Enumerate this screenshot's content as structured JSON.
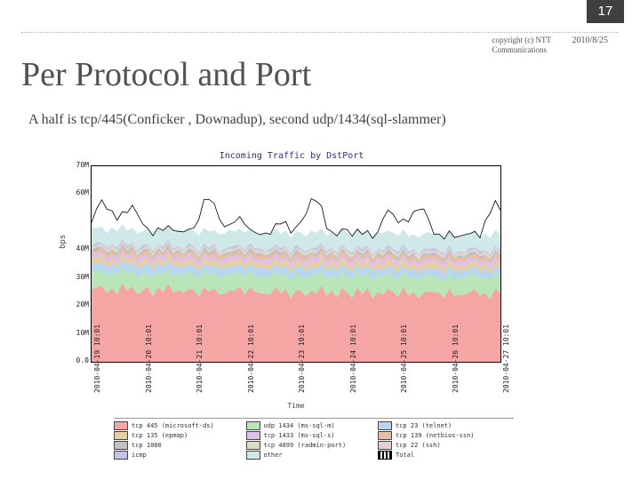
{
  "page_number": "17",
  "copyright_line1": "copyright (c) NTT",
  "copyright_line2": "Communications",
  "date": "2010/8/25",
  "title": "Per Protocol and Port",
  "subtitle": "A half is tcp/445(Conficker , Downadup), second udp/1434(sql-slammer)",
  "chart_data": {
    "type": "area",
    "title": "Incoming Traffic by DstPort",
    "xlabel": "Time",
    "ylabel": "bps",
    "ylim": [
      0,
      700000000
    ],
    "y_ticks": [
      "0.0",
      "10M",
      "20M",
      "30M",
      "40M",
      "60M",
      "70M"
    ],
    "categories": [
      "2010-04-19 10:01",
      "2010-04-20 10:01",
      "2010-04-21 10:01",
      "2010-04-22 10:01",
      "2010-04-23 10:01",
      "2010-04-24 10:01",
      "2010-04-25 10:01",
      "2010-04-26 10:01",
      "2010-04-27 10:01"
    ],
    "series": [
      {
        "name": "tcp 445 (microsoft-ds)",
        "color": "#f6a5a5",
        "values": [
          260,
          260,
          255,
          250,
          250,
          250,
          245,
          245,
          245
        ]
      },
      {
        "name": "udp 1434 (ms-sql-m)",
        "color": "#b9e6b9",
        "values": [
          60,
          60,
          60,
          60,
          60,
          60,
          60,
          60,
          60
        ]
      },
      {
        "name": "tcp 23 (telnet)",
        "color": "#b9d6f0",
        "values": [
          30,
          30,
          28,
          28,
          28,
          28,
          26,
          26,
          26
        ]
      },
      {
        "name": "tcp 135 (epmap)",
        "color": "#e6cfa0",
        "values": [
          18,
          18,
          18,
          18,
          18,
          18,
          18,
          18,
          18
        ]
      },
      {
        "name": "tcp 1433 (ms-sql-s)",
        "color": "#e0c0e8",
        "values": [
          15,
          15,
          15,
          15,
          15,
          15,
          15,
          15,
          15
        ]
      },
      {
        "name": "tcp 139 (netbios-ssn)",
        "color": "#e8bfa6",
        "values": [
          12,
          12,
          12,
          12,
          12,
          12,
          12,
          12,
          12
        ]
      },
      {
        "name": "tcp 1080",
        "color": "#c0c0c0",
        "values": [
          8,
          8,
          8,
          8,
          8,
          8,
          8,
          8,
          8
        ]
      },
      {
        "name": "tcp 4899 (radmin-port)",
        "color": "#dcdcc6",
        "values": [
          6,
          6,
          6,
          6,
          6,
          6,
          6,
          6,
          6
        ]
      },
      {
        "name": "tcp 22 (ssh)",
        "color": "#e6ccd6",
        "values": [
          5,
          5,
          5,
          5,
          5,
          5,
          5,
          5,
          5
        ]
      },
      {
        "name": "icmp",
        "color": "#c4c4e6",
        "values": [
          5,
          5,
          5,
          5,
          5,
          5,
          5,
          5,
          5
        ]
      },
      {
        "name": "other",
        "color": "#cfe8e8",
        "values": [
          55,
          55,
          55,
          55,
          55,
          55,
          55,
          55,
          55
        ]
      },
      {
        "name": "Total",
        "is_line": true,
        "color": "#000000",
        "values": [
          474,
          474,
          466,
          461,
          461,
          461,
          453,
          453,
          453
        ]
      }
    ],
    "total_noise_range_mbps": [
      380,
      580
    ]
  }
}
